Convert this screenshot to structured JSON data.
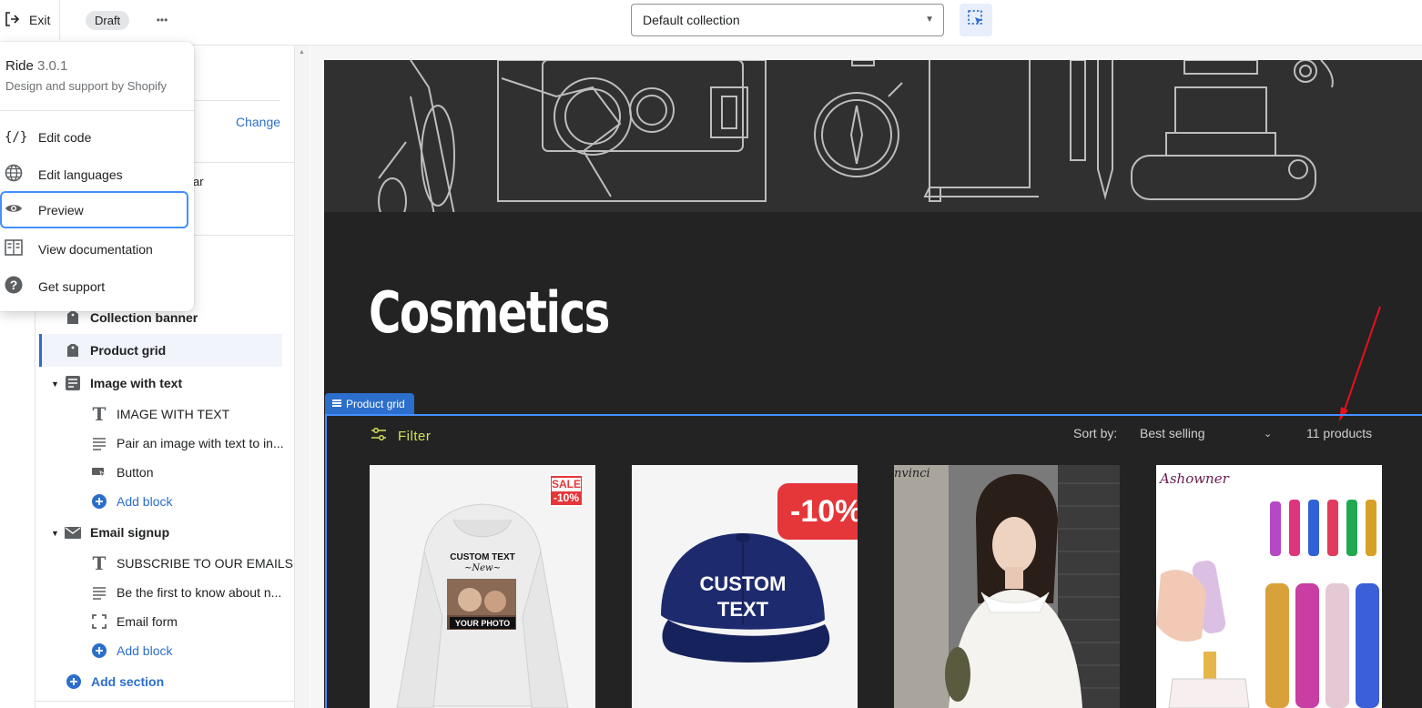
{
  "topbar": {
    "exit_label": "Exit",
    "status_badge": "Draft",
    "more_label": "•••",
    "template_select": "Default collection"
  },
  "theme_menu": {
    "theme_name": "Ride",
    "theme_version": "3.0.1",
    "theme_subtitle": "Design and support by Shopify",
    "items": [
      {
        "label": "Edit code",
        "icon": "code-icon"
      },
      {
        "label": "Edit languages",
        "icon": "globe-icon"
      },
      {
        "label": "Preview",
        "icon": "eye-icon"
      },
      {
        "label": "View documentation",
        "icon": "book-icon"
      },
      {
        "label": "Get support",
        "icon": "question-icon"
      }
    ]
  },
  "sidebar": {
    "change_label": "Change",
    "partial_text": "ar",
    "sections": [
      {
        "label": "Collection banner",
        "icon": "tag-icon"
      },
      {
        "label": "Product grid",
        "icon": "tag-icon",
        "selected": true
      },
      {
        "label": "Image with text",
        "icon": "text-block-icon",
        "expanded": true,
        "blocks": [
          {
            "label": "IMAGE WITH TEXT",
            "icon": "heading-icon"
          },
          {
            "label": "Pair an image with text to in...",
            "icon": "paragraph-icon"
          },
          {
            "label": "Button",
            "icon": "button-icon"
          }
        ],
        "add_block": "Add block"
      },
      {
        "label": "Email signup",
        "icon": "envelope-icon",
        "expanded": true,
        "blocks": [
          {
            "label": "SUBSCRIBE TO OUR EMAILS",
            "icon": "heading-icon"
          },
          {
            "label": "Be the first to know about n...",
            "icon": "paragraph-icon"
          },
          {
            "label": "Email form",
            "icon": "form-icon"
          }
        ],
        "add_block": "Add block"
      }
    ],
    "add_section": "Add section"
  },
  "preview": {
    "collection_title": "Cosmetics",
    "section_tab": "Product grid",
    "filter_label": "Filter",
    "sort_label": "Sort by:",
    "sort_value": "Best selling",
    "product_count": "11 products",
    "products": [
      {
        "badge_top": "SALE",
        "badge_bottom": "-10%",
        "print_text": "CUSTOM TEXT",
        "print_script": "~New~",
        "print_bottom": "YOUR PHOTO"
      },
      {
        "discount": "-10%",
        "cap_text_1": "CUSTOM",
        "cap_text_2": "TEXT"
      },
      {
        "brand": "nvinci"
      },
      {
        "brand": "Ashowner"
      }
    ]
  },
  "colors": {
    "accent": "#2c6ecb",
    "dark_bg": "#232323",
    "filter_text": "#d4e157",
    "sale_red": "#e5363a"
  }
}
